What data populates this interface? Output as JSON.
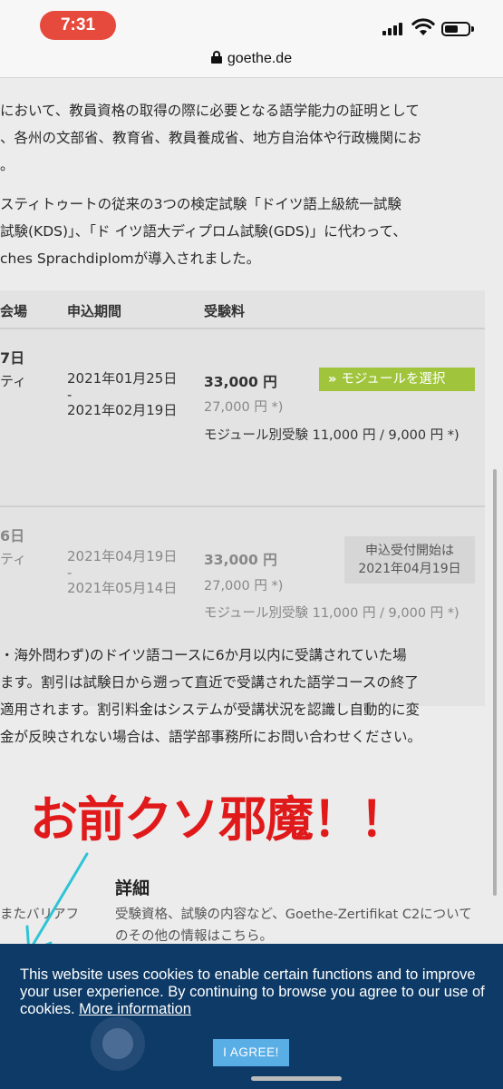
{
  "status_bar": {
    "time": "7:31"
  },
  "browser": {
    "domain": "goethe.de"
  },
  "intro_paragraph_1": [
    "において、教員資格の取得の際に必要となる語学能力の証明として",
    "、各州の文部省、教育省、教員養成省、地方自治体や行政機関にお",
    "。"
  ],
  "intro_paragraph_2": [
    "スティトゥートの従来の3つの検定試験「ドイツ語上級統一試験",
    "試験(KDS)」、「ド イツ語大ディプロム試験(GDS)」に代わって、",
    "ches Sprachdiplomが導入されました。"
  ],
  "table": {
    "headers": {
      "venue": "会場",
      "period": "申込期間",
      "fee": "受験料"
    },
    "rows": [
      {
        "date_fragment": "7日",
        "venue_fragment": "ティ",
        "period_start": "2021年01月25日",
        "period_dash": "-",
        "period_end": "2021年02月19日",
        "fee_main": "33,000 円",
        "fee_discount": "27,000 円 *)",
        "fee_module": "モジュール別受験 11,000 円 / 9,000 円 *)",
        "action_label": "モジュールを選択",
        "action_chevron": "»"
      },
      {
        "date_fragment": "6日",
        "venue_fragment": "ティ",
        "period_start": "2021年04月19日",
        "period_dash": "-",
        "period_end": "2021年05月14日",
        "fee_main": "33,000 円",
        "fee_discount": "27,000 円 *)",
        "fee_module": "モジュール別受験 11,000 円 / 9,000 円 *)",
        "pending_line1": "申込受付開始は",
        "pending_line2": "2021年04月19日"
      }
    ]
  },
  "discount_note": [
    "・海外問わず)のドイツ語コースに6か月以内に受講されていた場",
    "ます。割引は試験日から遡って直近で受講された語学コースの終了",
    "適用されます。割引料金はシステムが受講状況を認識し自動的に変",
    "金が反映されない場合は、語学部事務所にお問い合わせください。"
  ],
  "annotation": {
    "text": "お前クソ邪魔！！",
    "color": "#e01a1a",
    "arrow_color": "#2ec4d6"
  },
  "detail": {
    "title": "詳細",
    "text": "受験資格、試験の内容など、Goethe-Zertifikat C2についてのその他の情報はこちら。",
    "left_fragment": "またバリアフ"
  },
  "cookie_banner": {
    "text": "This website uses cookies to enable certain functions and to improve your user experience. By continuing to browse you agree to our use of cookies.",
    "link": "More information",
    "button": "I AGREE!"
  },
  "colors": {
    "time_pill": "#e64a3c",
    "select_button": "#a0c53d",
    "cookie_bg": "#0d3a66",
    "agree_button": "#5aaee6"
  }
}
